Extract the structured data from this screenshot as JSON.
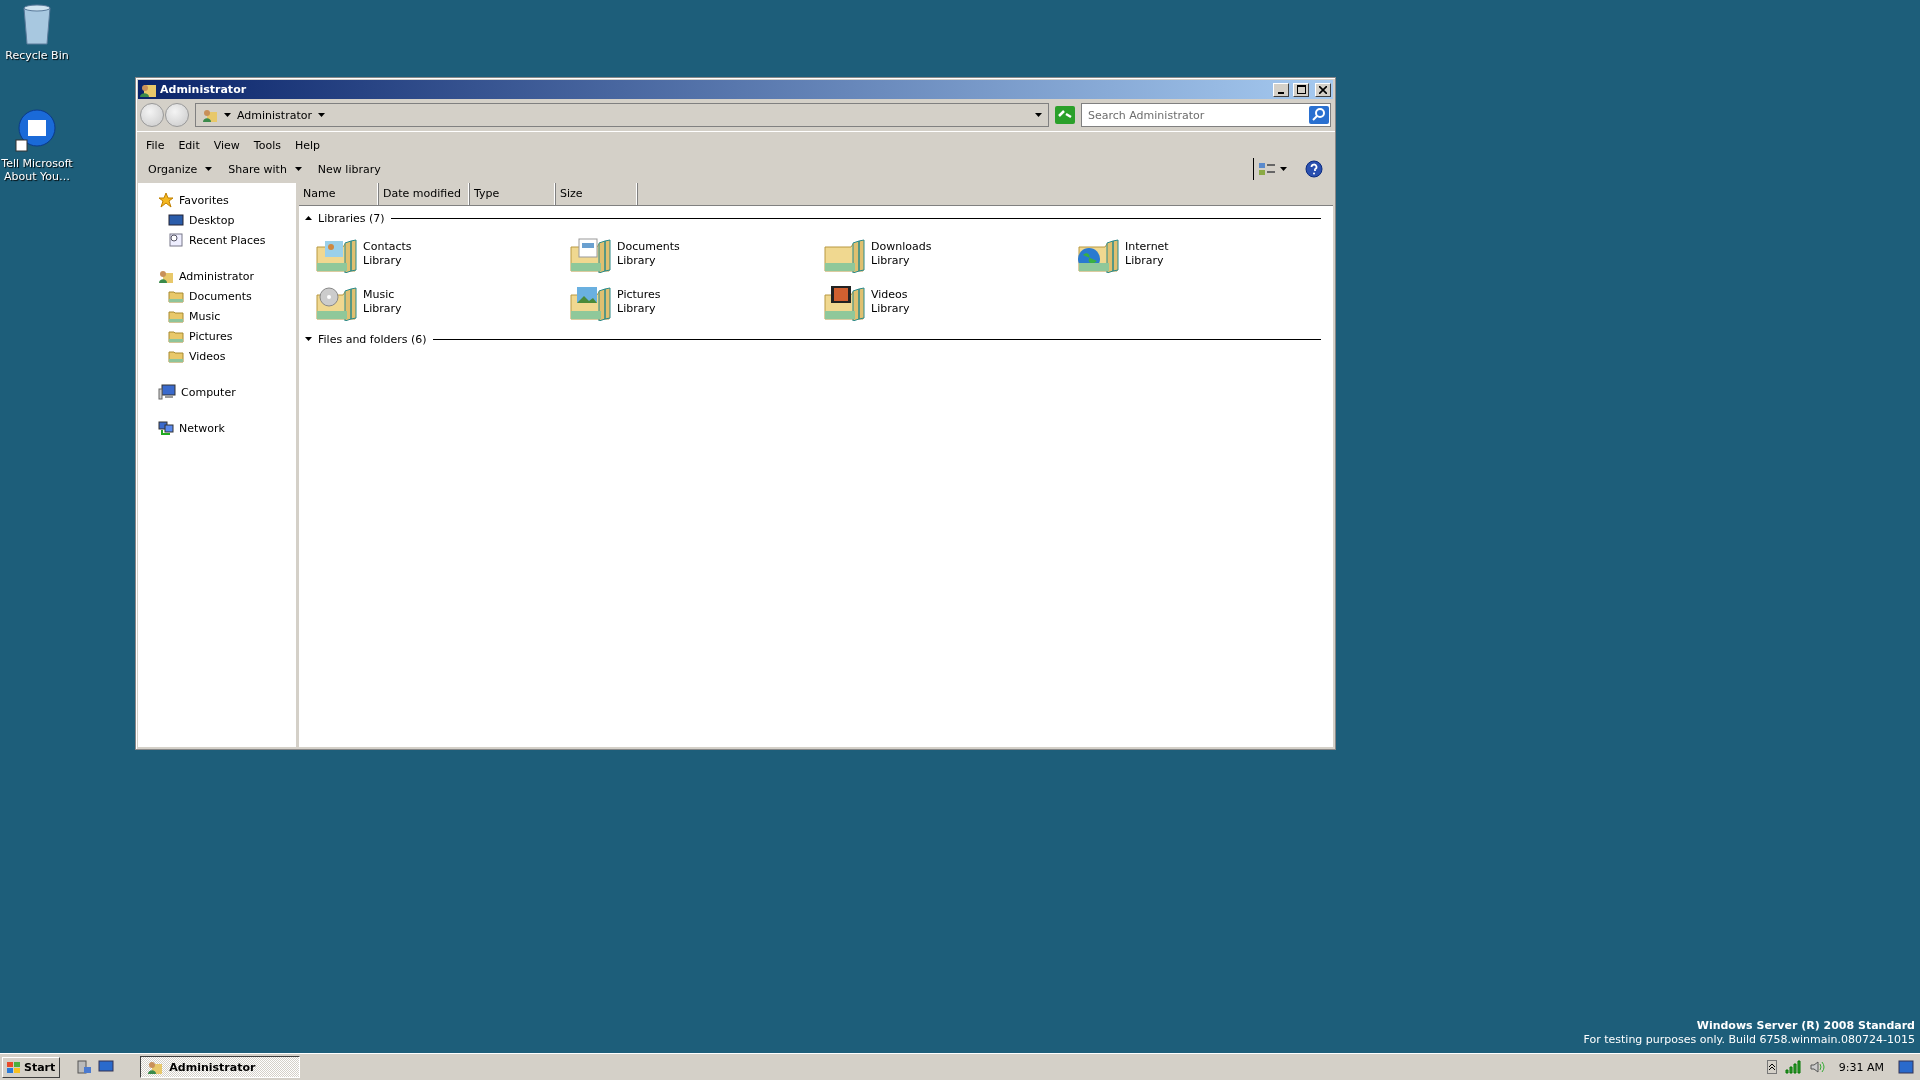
{
  "desktop_icons": [
    {
      "label": "Recycle Bin",
      "kind": "bin"
    },
    {
      "label": "Tell Microsoft About You…",
      "kind": "feedback"
    }
  ],
  "window": {
    "title": "Administrator"
  },
  "address_bar": {
    "path": "Administrator"
  },
  "search": {
    "placeholder": "Search Administrator"
  },
  "menu": [
    "File",
    "Edit",
    "View",
    "Tools",
    "Help"
  ],
  "command_bar": [
    {
      "label": "Organize",
      "dropdown": true
    },
    {
      "label": "Share with",
      "dropdown": true
    },
    {
      "label": "New library",
      "dropdown": false
    }
  ],
  "sidebar": [
    {
      "label": "Favorites",
      "kind": "star",
      "children": [
        {
          "label": "Desktop",
          "kind": "desktop"
        },
        {
          "label": "Recent Places",
          "kind": "recent"
        }
      ]
    },
    {
      "label": "Administrator",
      "kind": "user",
      "children": [
        {
          "label": "Documents",
          "kind": "folder"
        },
        {
          "label": "Music",
          "kind": "folder"
        },
        {
          "label": "Pictures",
          "kind": "folder"
        },
        {
          "label": "Videos",
          "kind": "folder"
        }
      ]
    },
    {
      "label": "Computer",
      "kind": "computer"
    },
    {
      "label": "Network",
      "kind": "network"
    }
  ],
  "columns": [
    "Name",
    "Date modified",
    "Type",
    "Size"
  ],
  "groups": [
    {
      "title": "Libraries (7)",
      "expanded": true,
      "items": [
        {
          "name": "Contacts",
          "type": "Library",
          "kind": "contacts"
        },
        {
          "name": "Documents",
          "type": "Library",
          "kind": "documents"
        },
        {
          "name": "Downloads",
          "type": "Library",
          "kind": "downloads"
        },
        {
          "name": "Internet",
          "type": "Library",
          "kind": "internet"
        },
        {
          "name": "Music",
          "type": "Library",
          "kind": "music"
        },
        {
          "name": "Pictures",
          "type": "Library",
          "kind": "pictures"
        },
        {
          "name": "Videos",
          "type": "Library",
          "kind": "videos"
        }
      ]
    },
    {
      "title": "Files and folders (6)",
      "expanded": false
    }
  ],
  "taskbar": {
    "start": "Start",
    "tasks": [
      {
        "label": "Administrator",
        "selected": true
      }
    ],
    "clock": "9:31 AM"
  },
  "watermark_os": {
    "edition": "Windows Server (R) 2008 Standard",
    "build": "For testing purposes only. Build 6758.winmain.080724-1015"
  }
}
